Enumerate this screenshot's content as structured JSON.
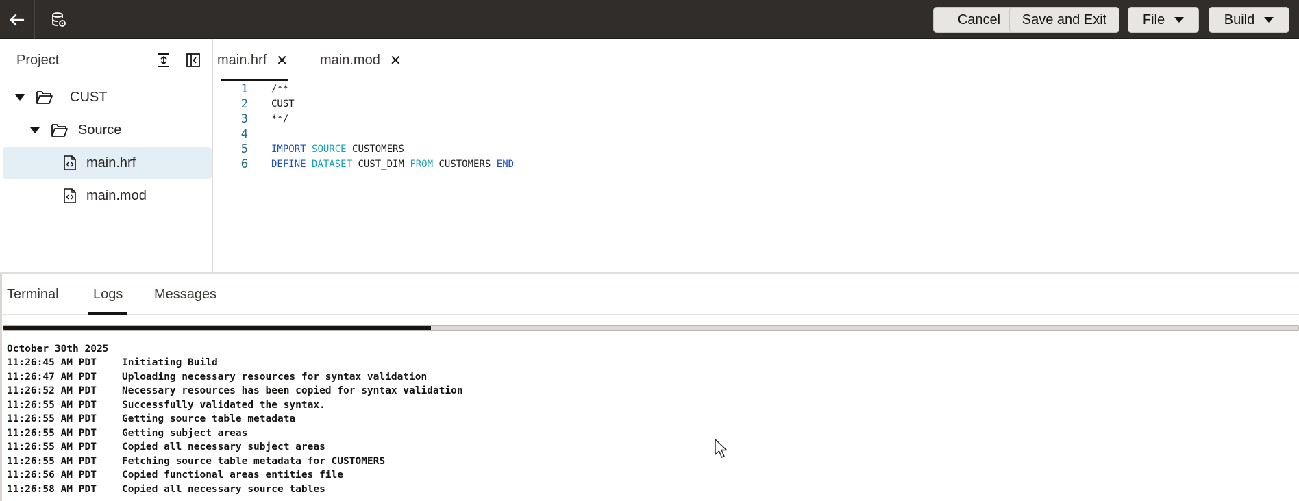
{
  "topbar": {
    "back_icon": "arrow-left-icon",
    "db_icon": "database-settings-icon",
    "cancel_label": "Cancel",
    "save_exit_label": "Save and Exit",
    "file_label": "File",
    "build_label": "Build"
  },
  "project": {
    "title": "Project",
    "tree": [
      {
        "label": "CUST",
        "type": "folder",
        "expanded": true
      },
      {
        "label": "Source",
        "type": "folder",
        "expanded": true
      },
      {
        "label": "main.hrf",
        "type": "file",
        "selected": true
      },
      {
        "label": "main.mod",
        "type": "file",
        "selected": false
      }
    ]
  },
  "editor": {
    "tabs": [
      {
        "label": "main.hrf",
        "active": true
      },
      {
        "label": "main.mod",
        "active": false
      }
    ],
    "lines": [
      {
        "num": "1",
        "text": "/**"
      },
      {
        "num": "2",
        "text": "CUST"
      },
      {
        "num": "3",
        "text": "**/"
      },
      {
        "num": "4",
        "text": ""
      },
      {
        "num": "5",
        "text": "IMPORT SOURCE CUSTOMERS"
      },
      {
        "num": "6",
        "text": "DEFINE DATASET CUST_DIM FROM CUSTOMERS END"
      }
    ]
  },
  "bottom_tabs": [
    {
      "label": "Terminal",
      "active": false
    },
    {
      "label": "Logs",
      "active": true
    },
    {
      "label": "Messages",
      "active": false
    }
  ],
  "progress": {
    "percent": 33
  },
  "logs": {
    "date": "October 30th 2025",
    "entries": [
      {
        "time": "11:26:45 AM PDT",
        "message": "Initiating Build"
      },
      {
        "time": "11:26:47 AM PDT",
        "message": "Uploading necessary resources for syntax validation"
      },
      {
        "time": "11:26:52 AM PDT",
        "message": "Necessary resources has been copied for syntax validation"
      },
      {
        "time": "11:26:55 AM PDT",
        "message": "Successfully validated the syntax."
      },
      {
        "time": "11:26:55 AM PDT",
        "message": "Getting source table metadata"
      },
      {
        "time": "11:26:55 AM PDT",
        "message": "Getting subject areas"
      },
      {
        "time": "11:26:55 AM PDT",
        "message": "Copied all necessary subject areas"
      },
      {
        "time": "11:26:55 AM PDT",
        "message": "Fetching source table metadata for CUSTOMERS"
      },
      {
        "time": "11:26:56 AM PDT",
        "message": "Copied functional areas entities file"
      },
      {
        "time": "11:26:58 AM PDT",
        "message": "Copied all necessary source tables"
      }
    ]
  }
}
